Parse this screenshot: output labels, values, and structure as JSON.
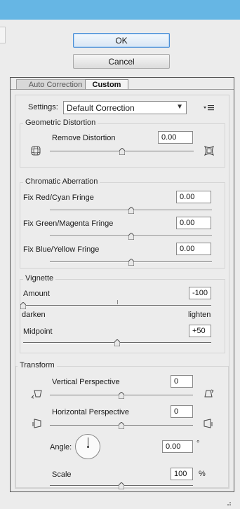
{
  "buttons": {
    "ok": "OK",
    "cancel": "Cancel"
  },
  "tabs": {
    "auto": "Auto Correction",
    "custom": "Custom"
  },
  "settings": {
    "label": "Settings:",
    "value": "Default Correction",
    "menu_icon": "flyout-menu-icon"
  },
  "geometric": {
    "title": "Geometric Distortion",
    "remove_label": "Remove Distortion",
    "remove_value": "0.00",
    "remove_level": 0.5
  },
  "chromatic": {
    "title": "Chromatic Aberration",
    "rows": [
      {
        "label": "Fix Red/Cyan Fringe",
        "value": "0.00",
        "level": 0.5
      },
      {
        "label": "Fix Green/Magenta Fringe",
        "value": "0.00",
        "level": 0.5
      },
      {
        "label": "Fix Blue/Yellow Fringe",
        "value": "0.00",
        "level": 0.5
      }
    ]
  },
  "vignette": {
    "title": "Vignette",
    "amount_label": "Amount",
    "amount_value": "-100",
    "amount_level": 0.0,
    "darken": "darken",
    "lighten": "lighten",
    "midpoint_label": "Midpoint",
    "midpoint_value": "+50",
    "midpoint_level": 0.5
  },
  "transform": {
    "title": "Transform",
    "vertical_label": "Vertical Perspective",
    "vertical_value": "0",
    "vertical_level": 0.5,
    "horizontal_label": "Horizontal Perspective",
    "horizontal_value": "0",
    "horizontal_level": 0.5,
    "angle_label": "Angle:",
    "angle_value": "0.00",
    "angle_unit": "°",
    "scale_label": "Scale",
    "scale_value": "100",
    "scale_unit": "%",
    "scale_level": 0.5
  },
  "colors": {
    "titlebar": "#66b6e4",
    "default_button": "#4a8ed6"
  }
}
